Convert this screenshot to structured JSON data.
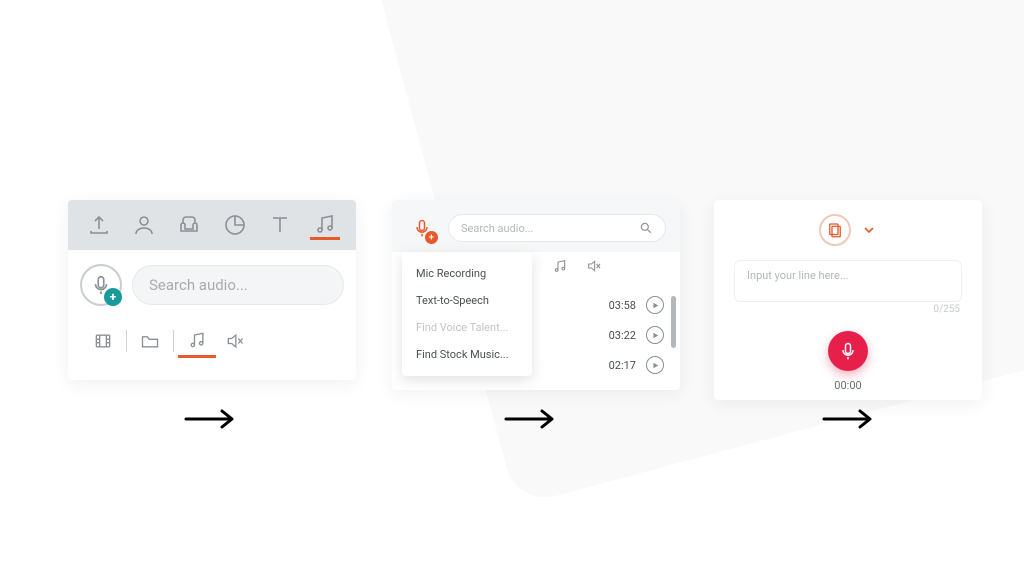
{
  "panel1": {
    "search_placeholder": "Search audio...",
    "top_icons": [
      "upload-icon",
      "person-icon",
      "armchair-icon",
      "pie-icon",
      "text-icon",
      "music-icon"
    ],
    "bottom_icons": [
      "film-icon",
      "folder-icon",
      "music-icon",
      "speaker-mute-icon"
    ]
  },
  "panel2": {
    "search_placeholder": "Search audio...",
    "menu": {
      "items": [
        {
          "label": "Mic Recording",
          "disabled": false
        },
        {
          "label": "Text-to-Speech",
          "disabled": false
        },
        {
          "label": "Find Voice Talent...",
          "disabled": true
        },
        {
          "label": "Find Stock Music...",
          "disabled": false
        }
      ]
    },
    "tracks": [
      {
        "duration": "03:58"
      },
      {
        "duration": "03:22"
      },
      {
        "duration": "02:17"
      }
    ]
  },
  "panel3": {
    "placeholder": "Input your line here...",
    "counter": "0/255",
    "timer": "00:00"
  }
}
